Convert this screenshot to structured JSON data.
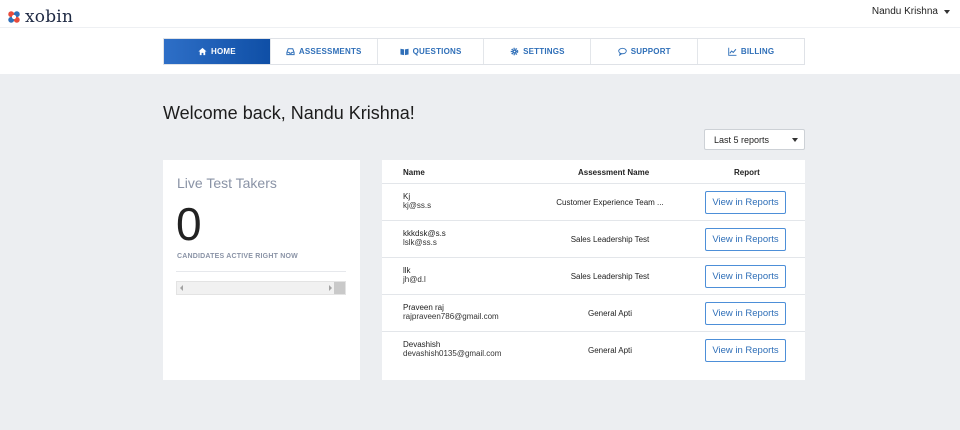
{
  "brand": {
    "name": "xobin"
  },
  "user": {
    "name": "Nandu Krishna"
  },
  "nav": [
    {
      "label": "HOME",
      "icon": "home-icon",
      "active": true
    },
    {
      "label": "ASSESSMENTS",
      "icon": "inbox-icon",
      "active": false
    },
    {
      "label": "QUESTIONS",
      "icon": "book-icon",
      "active": false
    },
    {
      "label": "SETTINGS",
      "icon": "gear-icon",
      "active": false
    },
    {
      "label": "SUPPORT",
      "icon": "chat-icon",
      "active": false
    },
    {
      "label": "BILLING",
      "icon": "chart-icon",
      "active": false
    }
  ],
  "welcome": "Welcome back, Nandu Krishna!",
  "filter": {
    "selected": "Last 5 reports"
  },
  "live": {
    "title": "Live Test Takers",
    "count": "0",
    "caption": "CANDIDATES ACTIVE RIGHT NOW"
  },
  "table": {
    "headers": {
      "name": "Name",
      "assessment": "Assessment Name",
      "report": "Report"
    },
    "rows": [
      {
        "name": "Kj",
        "email": "kj@ss.s",
        "assessment": "Customer Experience Team ...",
        "action": "View in Reports"
      },
      {
        "name": "kkkdsk@s.s",
        "email": "lslk@ss.s",
        "assessment": "Sales Leadership Test",
        "action": "View in Reports"
      },
      {
        "name": "llk",
        "email": "jh@d.l",
        "assessment": "Sales Leadership Test",
        "action": "View in Reports"
      },
      {
        "name": "Praveen raj",
        "email": "rajpraveen786@gmail.com",
        "assessment": "General Apti",
        "action": "View in Reports"
      },
      {
        "name": "Devashish",
        "email": "devashish0135@gmail.com",
        "assessment": "General Apti",
        "action": "View in Reports"
      }
    ]
  },
  "colors": {
    "accent": "#2f6fb8",
    "active_tab": "#1a5bb5",
    "background": "#eceef1"
  }
}
